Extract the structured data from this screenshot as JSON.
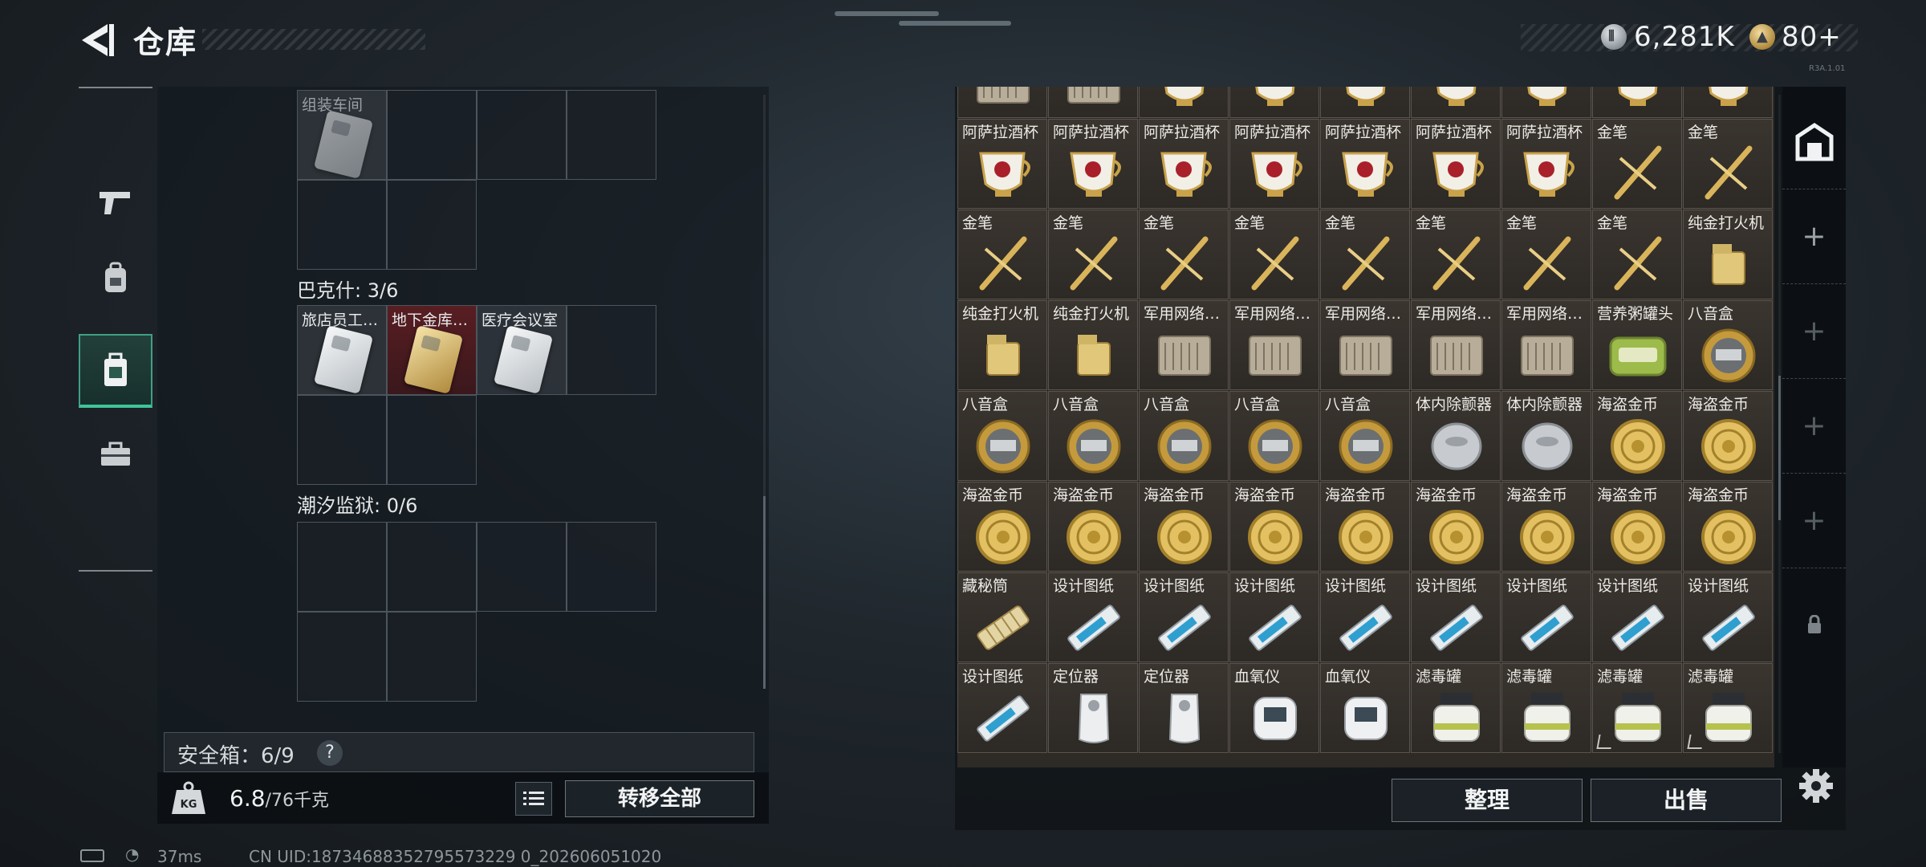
{
  "header": {
    "title": "仓库"
  },
  "currency": {
    "silver": "6,281K",
    "gold": "80+",
    "tiny_id": "R3A.1.01"
  },
  "sidebar": {
    "items": [
      {
        "icon": "pistol-icon",
        "active": false
      },
      {
        "icon": "backpack-icon",
        "active": false
      },
      {
        "icon": "case-icon",
        "active": true
      },
      {
        "icon": "toolbox-icon",
        "active": false
      }
    ]
  },
  "left": {
    "top_cell_label": "组装车间",
    "sections": [
      {
        "title": "巴克什: 3/6",
        "cells": [
          "旅店员工…",
          "地下金库…",
          "医疗会议室"
        ]
      },
      {
        "title": "潮汐监狱: 0/6",
        "cells": []
      }
    ],
    "safe_box": "安全箱：6/9",
    "help": "?",
    "weight_value": "6.8",
    "weight_max": "/76千克",
    "kg_label": "KG",
    "transfer_all": "转移全部"
  },
  "grid": {
    "rows": [
      [
        "",
        "",
        "",
        "",
        "",
        "",
        "",
        "",
        ""
      ],
      [
        "阿萨拉酒杯",
        "阿萨拉酒杯",
        "阿萨拉酒杯",
        "阿萨拉酒杯",
        "阿萨拉酒杯",
        "阿萨拉酒杯",
        "阿萨拉酒杯",
        "金笔",
        "金笔"
      ],
      [
        "金笔",
        "金笔",
        "金笔",
        "金笔",
        "金笔",
        "金笔",
        "金笔",
        "金笔",
        "纯金打火机"
      ],
      [
        "纯金打火机",
        "纯金打火机",
        "军用网络…",
        "军用网络…",
        "军用网络…",
        "军用网络…",
        "军用网络…",
        "营养粥罐头",
        "八音盒"
      ],
      [
        "八音盒",
        "八音盒",
        "八音盒",
        "八音盒",
        "八音盒",
        "体内除颤器",
        "体内除颤器",
        "海盗金币",
        "海盗金币"
      ],
      [
        "海盗金币",
        "海盗金币",
        "海盗金币",
        "海盗金币",
        "海盗金币",
        "海盗金币",
        "海盗金币",
        "海盗金币",
        "海盗金币"
      ],
      [
        "藏秘筒",
        "设计图纸",
        "设计图纸",
        "设计图纸",
        "设计图纸",
        "设计图纸",
        "设计图纸",
        "设计图纸",
        "设计图纸"
      ],
      [
        "设计图纸",
        "定位器",
        "定位器",
        "血氧仪",
        "血氧仪",
        "滤毒罐",
        "滤毒罐",
        "滤毒罐",
        "滤毒罐"
      ]
    ]
  },
  "buttons": {
    "sort": "整理",
    "sell": "出售"
  },
  "status": {
    "ping": "37ms",
    "uid": "CN UID:18734688352795573229 0_202606051020"
  },
  "colors": {
    "accent": "#3fc49a",
    "gold_item": "#d9b45a"
  }
}
